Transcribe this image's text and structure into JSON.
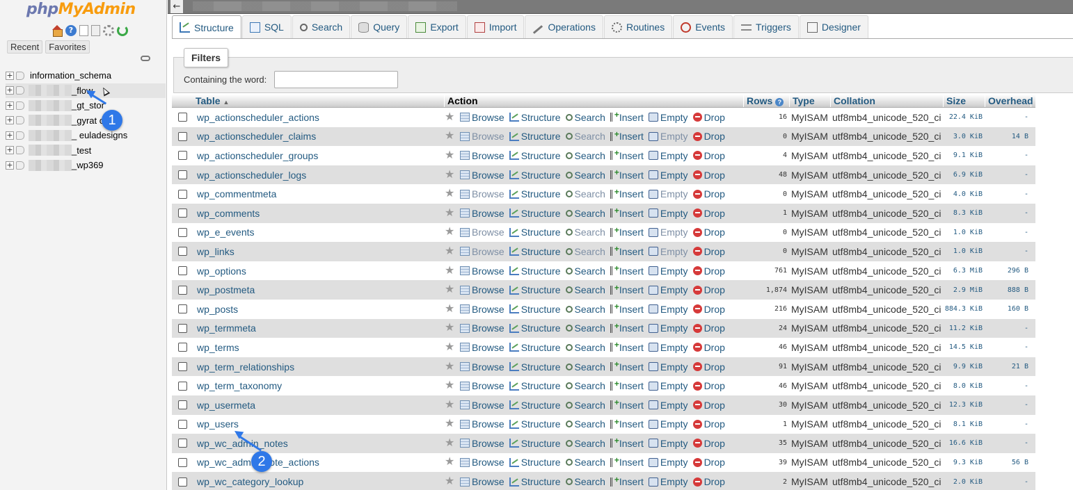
{
  "nav": {
    "logo_php": "php",
    "logo_myadmin": "MyAdmin",
    "icons": [
      "home-icon",
      "help-icon",
      "docs-icon",
      "docs-icon",
      "gear-icon",
      "reload-icon"
    ],
    "tabs": [
      "Recent",
      "Favorites"
    ],
    "databases": [
      {
        "name": "information_schema",
        "blurred": false
      },
      {
        "name": "_flow",
        "blurred": true,
        "highlight": true
      },
      {
        "name": "_gt_stor",
        "blurred": true
      },
      {
        "name": "_gyrat     chs",
        "blurred": true
      },
      {
        "name": "_        euladesigns",
        "blurred": true
      },
      {
        "name": "_test",
        "blurred": true
      },
      {
        "name": "_wp369",
        "blurred": true
      }
    ]
  },
  "callouts": [
    "1",
    "2"
  ],
  "tabs": [
    {
      "label": "Structure",
      "icon": "structure-icon",
      "active": true
    },
    {
      "label": "SQL",
      "icon": "sql-icon"
    },
    {
      "label": "Search",
      "icon": "search-icon"
    },
    {
      "label": "Query",
      "icon": "query-icon"
    },
    {
      "label": "Export",
      "icon": "export-icon"
    },
    {
      "label": "Import",
      "icon": "import-icon"
    },
    {
      "label": "Operations",
      "icon": "wrench-icon"
    },
    {
      "label": "Routines",
      "icon": "routines-icon"
    },
    {
      "label": "Events",
      "icon": "clock-icon"
    },
    {
      "label": "Triggers",
      "icon": "triggers-icon"
    },
    {
      "label": "Designer",
      "icon": "designer-icon"
    }
  ],
  "filters": {
    "legend": "Filters",
    "label": "Containing the word:",
    "value": ""
  },
  "table": {
    "headers": {
      "table": "Table",
      "action": "Action",
      "rows": "Rows",
      "type": "Type",
      "collation": "Collation",
      "size": "Size",
      "overhead": "Overhead"
    },
    "actions": [
      "Browse",
      "Structure",
      "Search",
      "Insert",
      "Empty",
      "Drop"
    ],
    "rows": [
      {
        "name": "wp_actionscheduler_actions",
        "rows": "16",
        "type": "MyISAM",
        "collation": "utf8mb4_unicode_520_ci",
        "size": "22.4 KiB",
        "overhead": "-"
      },
      {
        "name": "wp_actionscheduler_claims",
        "rows": "0",
        "type": "MyISAM",
        "collation": "utf8mb4_unicode_520_ci",
        "size": "3.0 KiB",
        "overhead": "14 B"
      },
      {
        "name": "wp_actionscheduler_groups",
        "rows": "4",
        "type": "MyISAM",
        "collation": "utf8mb4_unicode_520_ci",
        "size": "9.1 KiB",
        "overhead": "-"
      },
      {
        "name": "wp_actionscheduler_logs",
        "rows": "48",
        "type": "MyISAM",
        "collation": "utf8mb4_unicode_520_ci",
        "size": "6.9 KiB",
        "overhead": "-"
      },
      {
        "name": "wp_commentmeta",
        "rows": "0",
        "type": "MyISAM",
        "collation": "utf8mb4_unicode_520_ci",
        "size": "4.0 KiB",
        "overhead": "-"
      },
      {
        "name": "wp_comments",
        "rows": "1",
        "type": "MyISAM",
        "collation": "utf8mb4_unicode_520_ci",
        "size": "8.3 KiB",
        "overhead": "-"
      },
      {
        "name": "wp_e_events",
        "rows": "0",
        "type": "MyISAM",
        "collation": "utf8mb4_unicode_520_ci",
        "size": "1.0 KiB",
        "overhead": "-"
      },
      {
        "name": "wp_links",
        "rows": "0",
        "type": "MyISAM",
        "collation": "utf8mb4_unicode_520_ci",
        "size": "1.0 KiB",
        "overhead": "-"
      },
      {
        "name": "wp_options",
        "rows": "761",
        "type": "MyISAM",
        "collation": "utf8mb4_unicode_520_ci",
        "size": "6.3 MiB",
        "overhead": "296 B"
      },
      {
        "name": "wp_postmeta",
        "rows": "1,874",
        "type": "MyISAM",
        "collation": "utf8mb4_unicode_520_ci",
        "size": "2.9 MiB",
        "overhead": "888 B"
      },
      {
        "name": "wp_posts",
        "rows": "216",
        "type": "MyISAM",
        "collation": "utf8mb4_unicode_520_ci",
        "size": "884.3 KiB",
        "overhead": "160 B"
      },
      {
        "name": "wp_termmeta",
        "rows": "24",
        "type": "MyISAM",
        "collation": "utf8mb4_unicode_520_ci",
        "size": "11.2 KiB",
        "overhead": "-"
      },
      {
        "name": "wp_terms",
        "rows": "46",
        "type": "MyISAM",
        "collation": "utf8mb4_unicode_520_ci",
        "size": "14.5 KiB",
        "overhead": "-"
      },
      {
        "name": "wp_term_relationships",
        "rows": "91",
        "type": "MyISAM",
        "collation": "utf8mb4_unicode_520_ci",
        "size": "9.9 KiB",
        "overhead": "21 B"
      },
      {
        "name": "wp_term_taxonomy",
        "rows": "46",
        "type": "MyISAM",
        "collation": "utf8mb4_unicode_520_ci",
        "size": "8.0 KiB",
        "overhead": "-"
      },
      {
        "name": "wp_usermeta",
        "rows": "30",
        "type": "MyISAM",
        "collation": "utf8mb4_unicode_520_ci",
        "size": "12.3 KiB",
        "overhead": "-"
      },
      {
        "name": "wp_users",
        "rows": "1",
        "type": "MyISAM",
        "collation": "utf8mb4_unicode_520_ci",
        "size": "8.1 KiB",
        "overhead": "-"
      },
      {
        "name": "wp_wc_admin_notes",
        "rows": "35",
        "type": "MyISAM",
        "collation": "utf8mb4_unicode_520_ci",
        "size": "16.6 KiB",
        "overhead": "-"
      },
      {
        "name": "wp_wc_admin_note_actions",
        "rows": "39",
        "type": "MyISAM",
        "collation": "utf8mb4_unicode_520_ci",
        "size": "9.3 KiB",
        "overhead": "56 B"
      },
      {
        "name": "wp_wc_category_lookup",
        "rows": "2",
        "type": "MyISAM",
        "collation": "utf8mb4_unicode_520_ci",
        "size": "2.0 KiB",
        "overhead": "-"
      }
    ]
  },
  "colors": {
    "link": "#235a81",
    "callout": "#2f78e8",
    "row_alt": "#dfdfdf"
  }
}
